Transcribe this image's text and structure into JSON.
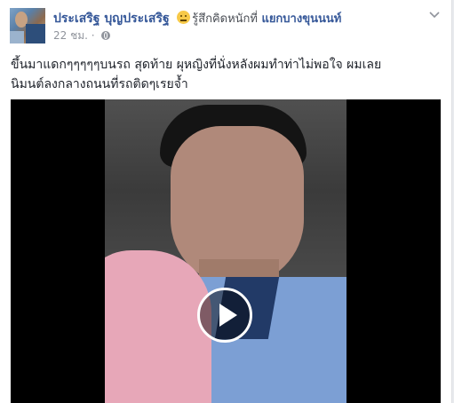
{
  "post": {
    "author": "ประเสริฐ บุญประเสริฐ",
    "feeling": "รู้สึกคิดหนักที่",
    "location": "แยกบางขุนนนท์",
    "timestamp": "22 ชม.",
    "separator": "·",
    "privacy_icon": "globe-icon",
    "menu_icon": "chevron-down-icon",
    "text_line1": "ขึ้นมาแดกๆๆๆๆๆบนรถ สุดท้าย ผุหญิงที่นั่งหลังผมทำท่าไม่พอใจ ผมเลย",
    "text_line2": "นิมนต์ลงกลางถนนที่รถติดๆเรยจ้ำ",
    "video": {
      "play_icon": "play-icon"
    }
  },
  "colors": {
    "link": "#365899",
    "meta": "#90949c",
    "text": "#1d2129",
    "video_bg": "#000000"
  }
}
